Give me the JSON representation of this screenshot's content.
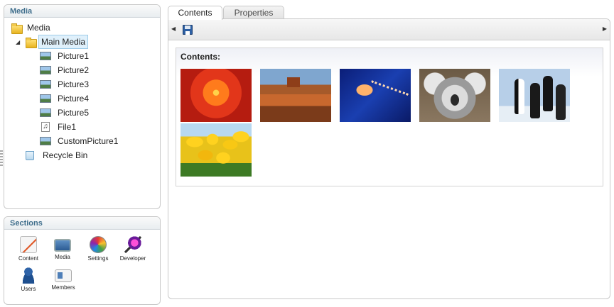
{
  "media_panel": {
    "title": "Media",
    "tree": {
      "root": {
        "label": "Media",
        "icon": "folder-icon"
      },
      "main_media": {
        "label": "Main Media",
        "icon": "folder-icon",
        "selected": true
      },
      "children": [
        {
          "label": "Picture1",
          "icon": "picture-icon"
        },
        {
          "label": "Picture2",
          "icon": "picture-icon"
        },
        {
          "label": "Picture3",
          "icon": "picture-icon"
        },
        {
          "label": "Picture4",
          "icon": "picture-icon"
        },
        {
          "label": "Picture5",
          "icon": "picture-icon"
        },
        {
          "label": "File1",
          "icon": "music-file-icon"
        },
        {
          "label": "CustomPicture1",
          "icon": "picture-icon"
        }
      ],
      "recycle_bin": {
        "label": "Recycle Bin",
        "icon": "recycle-bin-icon"
      }
    }
  },
  "sections_panel": {
    "title": "Sections",
    "items": [
      {
        "label": "Content",
        "icon": "content-icon"
      },
      {
        "label": "Media",
        "icon": "media-icon"
      },
      {
        "label": "Settings",
        "icon": "settings-icon"
      },
      {
        "label": "Developer",
        "icon": "developer-icon"
      },
      {
        "label": "Users",
        "icon": "users-icon"
      },
      {
        "label": "Members",
        "icon": "members-icon"
      }
    ]
  },
  "tabs": [
    {
      "label": "Contents",
      "active": true
    },
    {
      "label": "Properties",
      "active": false
    }
  ],
  "toolbar": {
    "icons": [
      "scroll-left-icon",
      "save-icon",
      "scroll-right-icon"
    ]
  },
  "contents": {
    "title": "Contents:",
    "thumbnails": [
      {
        "subject": "flower"
      },
      {
        "subject": "desert"
      },
      {
        "subject": "jellyfish"
      },
      {
        "subject": "koala"
      },
      {
        "subject": "penguins"
      },
      {
        "subject": "tulips"
      }
    ]
  }
}
